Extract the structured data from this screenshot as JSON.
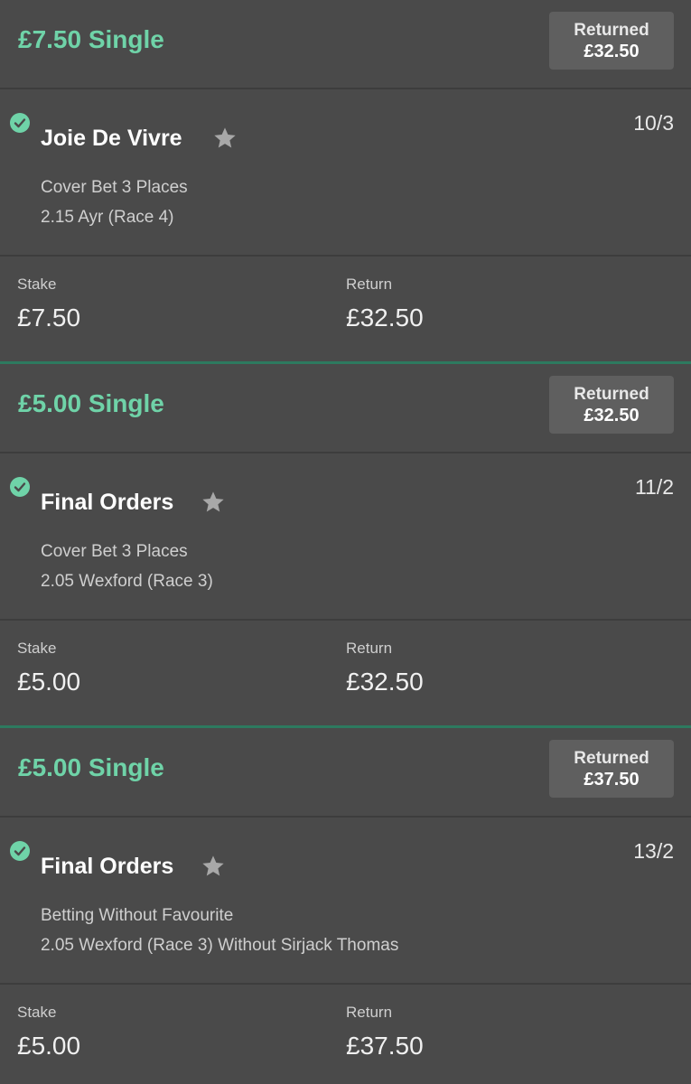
{
  "colors": {
    "background": "#4a4a4a",
    "accent_green": "#6fd3a8",
    "returned_box": "#5f5f5f",
    "divider_green": "#2d7a5f"
  },
  "icons": {
    "check": "check-circle-icon",
    "star": "star-icon"
  },
  "bets": [
    {
      "title": "£7.50 Single",
      "returned_label": "Returned",
      "returned_amount": "£32.50",
      "selection": "Joie De Vivre",
      "odds": "10/3",
      "market": "Cover Bet 3 Places",
      "event": "2.15 Ayr (Race 4)",
      "stake_label": "Stake",
      "stake": "£7.50",
      "return_label": "Return",
      "return": "£32.50"
    },
    {
      "title": "£5.00 Single",
      "returned_label": "Returned",
      "returned_amount": "£32.50",
      "selection": "Final Orders",
      "odds": "11/2",
      "market": "Cover Bet 3 Places",
      "event": "2.05 Wexford (Race 3)",
      "stake_label": "Stake",
      "stake": "£5.00",
      "return_label": "Return",
      "return": "£32.50"
    },
    {
      "title": "£5.00 Single",
      "returned_label": "Returned",
      "returned_amount": "£37.50",
      "selection": "Final Orders",
      "odds": "13/2",
      "market": "Betting Without Favourite",
      "event": "2.05 Wexford (Race 3) Without Sirjack Thomas",
      "stake_label": "Stake",
      "stake": "£5.00",
      "return_label": "Return",
      "return": "£37.50"
    }
  ]
}
